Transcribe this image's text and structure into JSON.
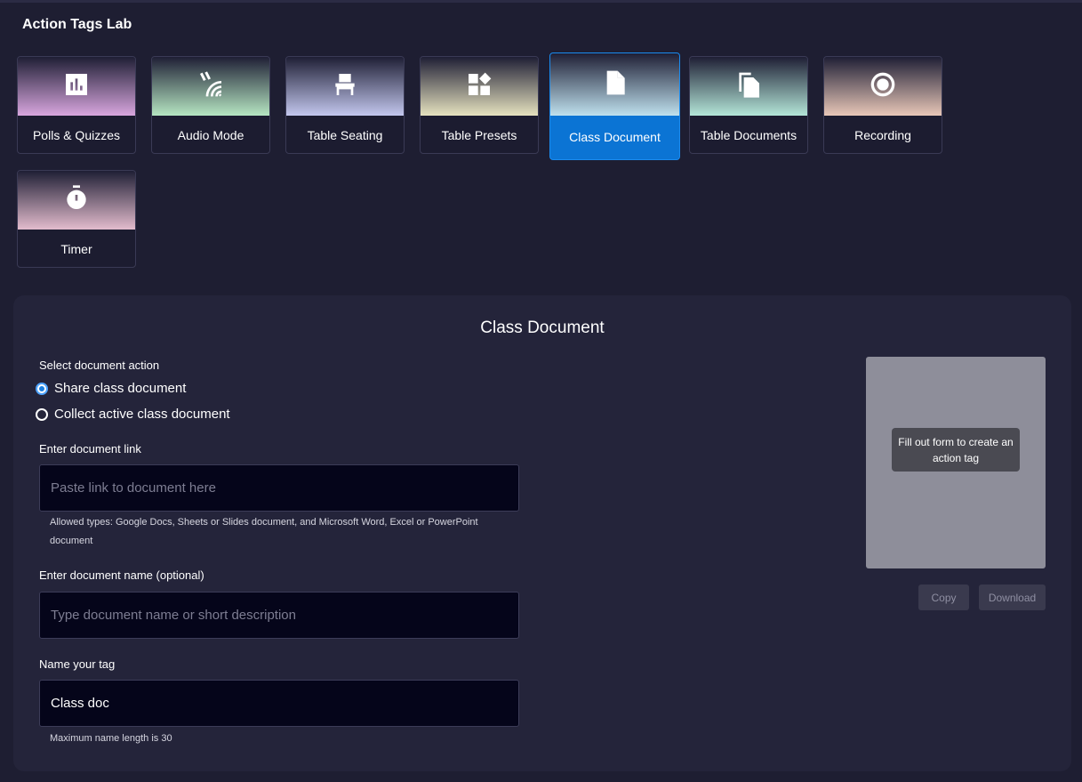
{
  "app": {
    "title": "Action Tags Lab"
  },
  "tiles": [
    {
      "label": "Polls & Quizzes",
      "icon": "poll-chart-icon",
      "gradient": [
        "#1f1f35",
        "#d8a6de"
      ],
      "selected": false
    },
    {
      "label": "Audio Mode",
      "icon": "audio-waves-icon",
      "gradient": [
        "#1f1f35",
        "#b6e6c2"
      ],
      "selected": false
    },
    {
      "label": "Table Seating",
      "icon": "chair-icon",
      "gradient": [
        "#1f1f35",
        "#c3c7ee"
      ],
      "selected": false
    },
    {
      "label": "Table Presets",
      "icon": "shapes-icon",
      "gradient": [
        "#1f1f35",
        "#e6e2bf"
      ],
      "selected": false
    },
    {
      "label": "Class Document",
      "icon": "document-icon",
      "gradient": [
        "#1f1f35",
        "#bfe1ee"
      ],
      "selected": true
    },
    {
      "label": "Table Documents",
      "icon": "documents-copy-icon",
      "gradient": [
        "#1f1f35",
        "#b4e6d8"
      ],
      "selected": false
    },
    {
      "label": "Recording",
      "icon": "record-icon",
      "gradient": [
        "#1f1f35",
        "#e8c7b8"
      ],
      "selected": false
    },
    {
      "label": "Timer",
      "icon": "stopwatch-icon",
      "gradient": [
        "#1f1f35",
        "#e3bccd"
      ],
      "selected": false
    }
  ],
  "panel": {
    "title": "Class Document",
    "action_label": "Select document action",
    "options": [
      {
        "label": "Share class document",
        "checked": true
      },
      {
        "label": "Collect active class document",
        "checked": false
      }
    ],
    "link": {
      "label": "Enter document link",
      "placeholder": "Paste link to document here",
      "value": "",
      "hint": "Allowed types: Google Docs, Sheets or Slides document, and Microsoft Word, Excel or PowerPoint document"
    },
    "doc_name": {
      "label": "Enter document name (optional)",
      "placeholder": "Type document name or short description",
      "value": ""
    },
    "tag_name": {
      "label": "Name your tag",
      "placeholder": "",
      "value": "Class doc",
      "hint": "Maximum name length is 30"
    },
    "preview": {
      "tip": "Fill out form to create an action tag",
      "copy_label": "Copy",
      "download_label": "Download"
    }
  },
  "colors": {
    "background": "#1e1e32",
    "panel": "#24243a",
    "accent": "#0b74d4",
    "input_bg": "#05051a"
  }
}
